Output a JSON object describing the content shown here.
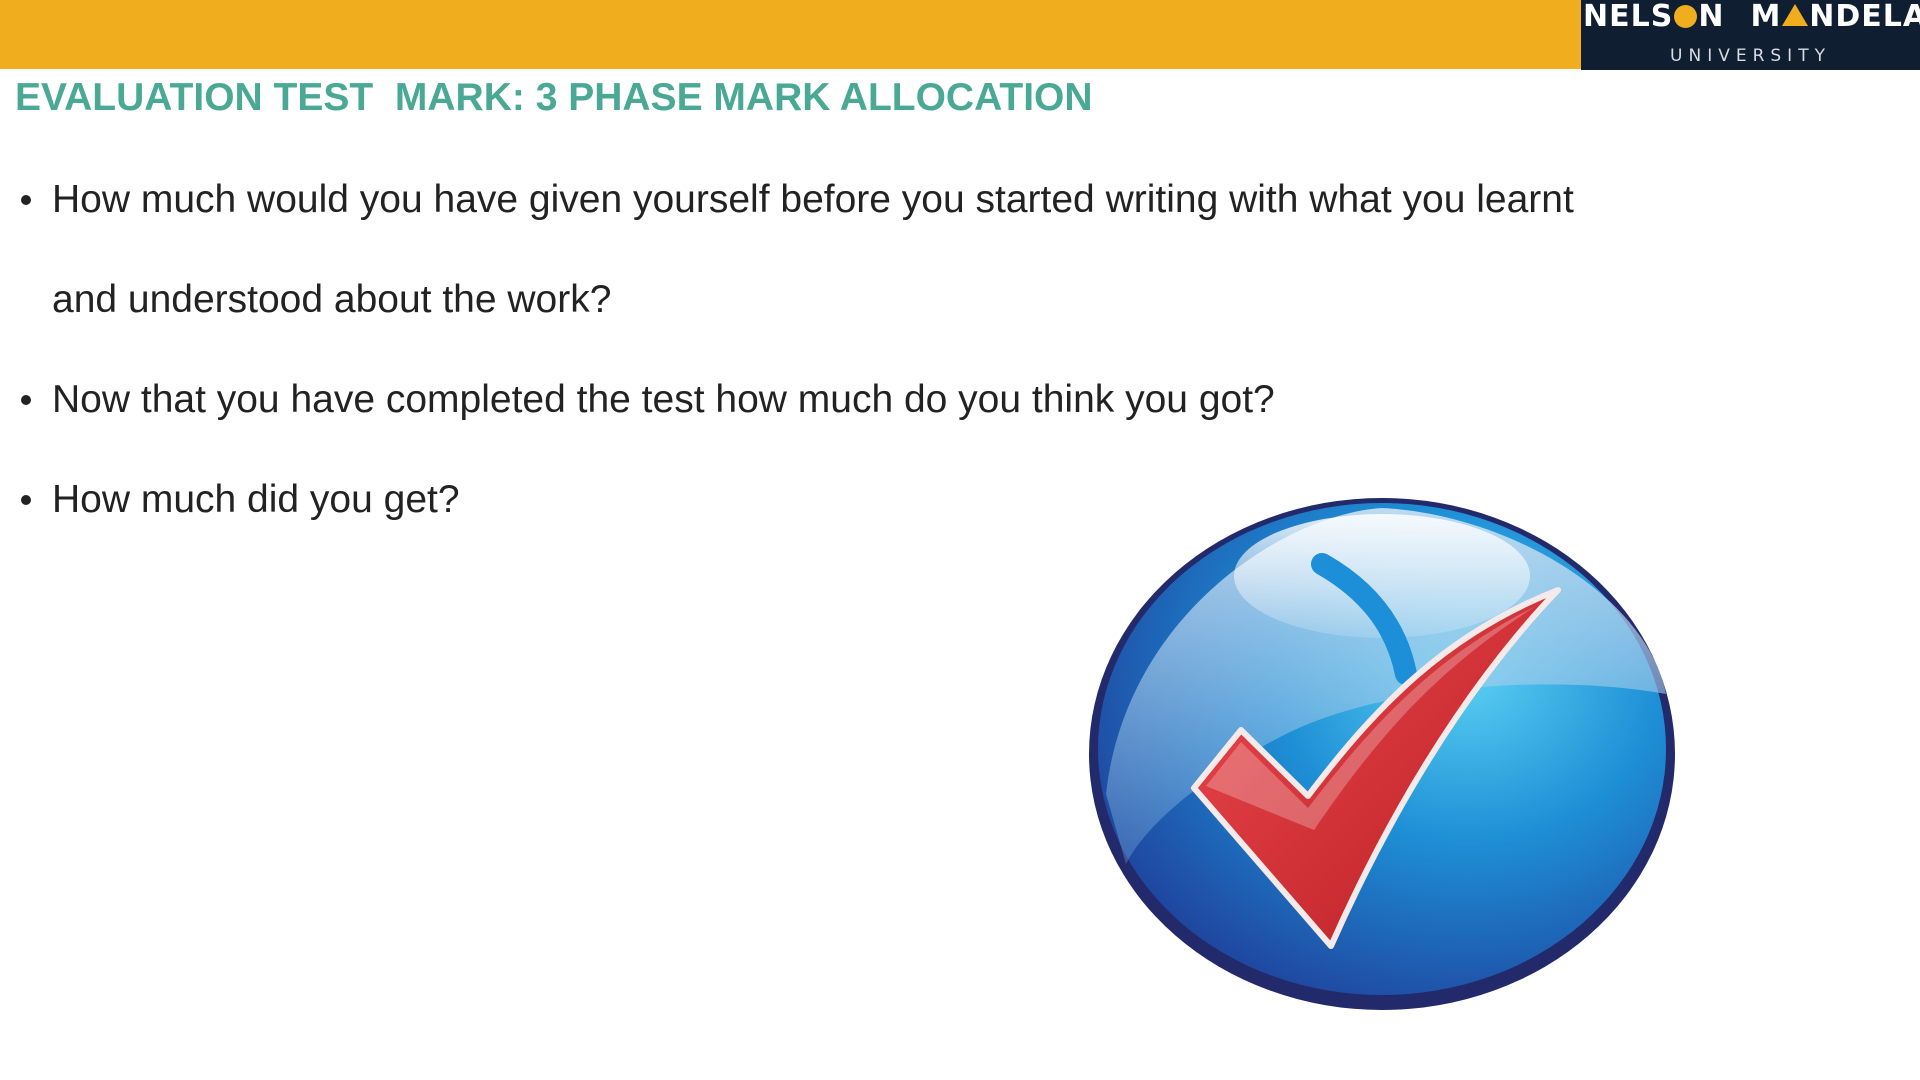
{
  "header": {
    "logo": {
      "name_part1": "NELS",
      "name_part2": "N",
      "name_part3": "M",
      "name_part4": "NDELA",
      "subtitle": "UNIVERSITY",
      "dot_color": "#f0ae1e"
    },
    "bar_color": "#f0ae1e",
    "logo_bg": "#0f1e30"
  },
  "slide": {
    "title": "EVALUATION TEST  MARK: 3 PHASE MARK ALLOCATION",
    "title_color": "#4aa995",
    "bullets": [
      {
        "line1": "How much would you have given yourself before you started writing with what you learnt",
        "line2": "and understood about the work?"
      },
      {
        "text": "Now that you have completed the test how much do you think you got?"
      },
      {
        "text": "How much did you get?"
      }
    ]
  },
  "graphic": {
    "icon": "checkmark-icon",
    "colors": {
      "disc": "#1e6fc0",
      "rim": "#232a6b",
      "check": "#d7262b"
    }
  }
}
